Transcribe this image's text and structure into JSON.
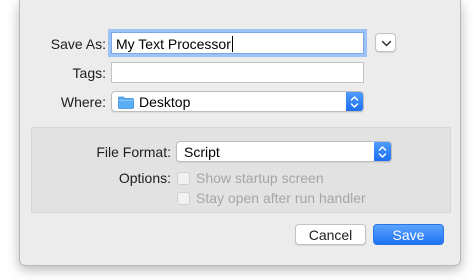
{
  "save_as": {
    "label": "Save As:",
    "value": "My Text Processor"
  },
  "tags": {
    "label": "Tags:",
    "value": ""
  },
  "where": {
    "label": "Where:",
    "value": "Desktop",
    "icon": "folder-icon"
  },
  "options_panel": {
    "file_format": {
      "label": "File Format:",
      "value": "Script"
    },
    "options_label": "Options:",
    "checkboxes": [
      {
        "label": "Show startup screen",
        "checked": false,
        "enabled": false
      },
      {
        "label": "Stay open after run handler",
        "checked": false,
        "enabled": false
      }
    ]
  },
  "buttons": {
    "cancel": "Cancel",
    "save": "Save"
  },
  "colors": {
    "accent": "#1f71f3",
    "focus_ring": "#9dc2f5",
    "folder": "#5aaef5"
  }
}
